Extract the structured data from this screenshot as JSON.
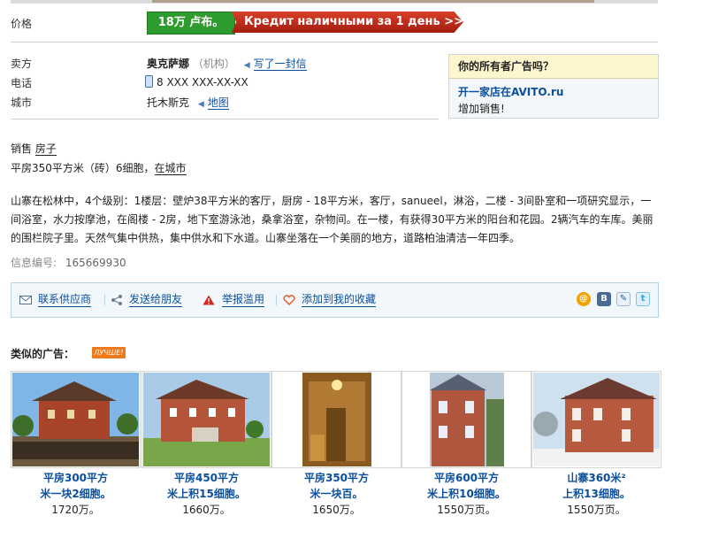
{
  "price": {
    "label": "价格",
    "value": "18万 卢布。",
    "credit_banner": "Кредит наличными за 1 день >>"
  },
  "seller": {
    "seller_label": "卖方",
    "seller_name": "奥克萨娜",
    "seller_type": "（机构）",
    "write_letter": "写了一封信",
    "phone_label": "电话",
    "phone_value": "8 XXX XXX-XX-XX",
    "city_label": "城市",
    "city_value": "托木斯克",
    "map_link": "地图"
  },
  "owner_box": {
    "title": "你的所有者广告吗？",
    "link": "开一家店在AVITO.ru",
    "subtitle": "增加销售!"
  },
  "category": {
    "prefix": "销售",
    "link": "房子"
  },
  "summary": {
    "text": "平房350平方米（砖）6细胞，",
    "link": "在城市"
  },
  "description": "山寨在松林中，4个级别：1楼层：壁炉38平方米的客厅，厨房 - 18平方米，客厅，sanueel，淋浴，二楼 - 3间卧室和一项研究显示，一间浴室，水力按摩池，在阁楼 - 2房，地下室游泳池，桑拿浴室，杂物间。在一楼，有获得30平方米的阳台和花园。2辆汽车的车库。美丽的围栏院子里。天然气集中供热，集中供水和下水道。山寨坐落在一个美丽的地方，道路柏油清洁一年四季。",
  "listing_id": {
    "label": "信息编号:",
    "value": "165669930"
  },
  "actions": {
    "contact": "联系供应商",
    "send_friend": "发送给朋友",
    "report": "举报滥用",
    "favorite": "添加到我的收藏"
  },
  "share_icons": [
    "mail-ru-icon",
    "vkontakte-icon",
    "livejournal-icon",
    "twitter-icon"
  ],
  "similar": {
    "title": "类似的广告：",
    "badge": "ЛУЧШЕ!",
    "items": [
      {
        "line1": "平房300平方",
        "line2": "米一块2细胞。",
        "price": "1720万。"
      },
      {
        "line1": "平房450平方",
        "line2": "米上积15细胞。",
        "price": "1660万。"
      },
      {
        "line1": "平房350平方",
        "line2": "米一块百。",
        "price": "1650万。"
      },
      {
        "line1": "平房600平方",
        "line2": "米上积10细胞。",
        "price": "1550万页。"
      },
      {
        "line1": "山寨360米²",
        "line2": "上积13细胞。",
        "price": "1550万页。"
      }
    ]
  },
  "colors": {
    "link": "#0a4f9e",
    "price_green": "#2e9b2e",
    "credit_red": "#c22b18",
    "owner_header": "#fdf6cf",
    "action_bar": "#f2f7fb",
    "badge_orange": "#f07a1a"
  }
}
